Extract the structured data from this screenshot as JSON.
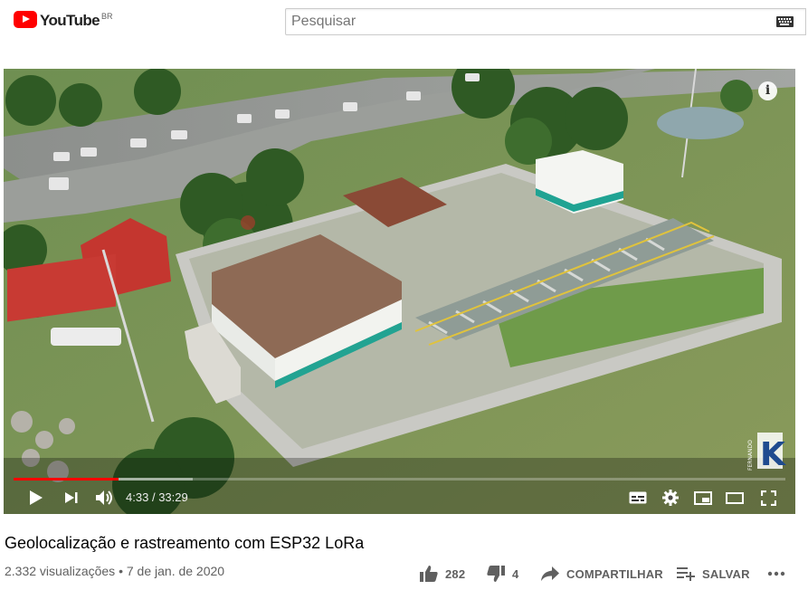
{
  "header": {
    "logo_text": "YouTube",
    "country_code": "BR",
    "search_placeholder": "Pesquisar"
  },
  "player": {
    "time_current": "4:33",
    "time_separator": "/",
    "time_total": "33:29",
    "progress_played_fraction": 0.136,
    "progress_buffered_fraction": 0.232,
    "watermark_text": "FERNANDO",
    "watermark_letter": "K",
    "accent_color": "#ff0000"
  },
  "video": {
    "title": "Geolocalização e rastreamento com ESP32 LoRa",
    "views": "2.332 visualizações",
    "separator": "•",
    "date": "7 de jan. de 2020"
  },
  "actions": {
    "likes": "282",
    "dislikes": "4",
    "share_label": "COMPARTILHAR",
    "save_label": "SALVAR"
  }
}
